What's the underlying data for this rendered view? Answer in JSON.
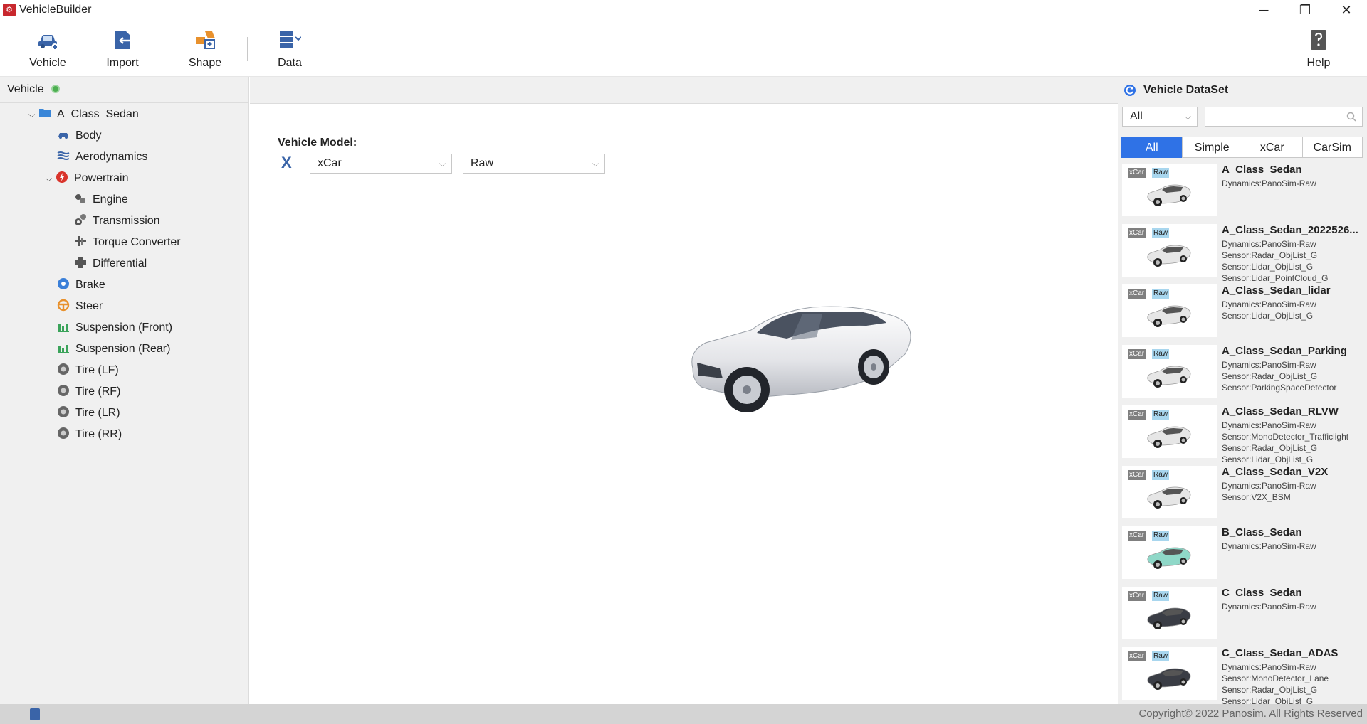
{
  "app": {
    "title": "VehicleBuilder",
    "icon": "app-logo-icon"
  },
  "window_controls": {
    "minimize": "─",
    "maximize": "❐",
    "close": "✕"
  },
  "toolbar": {
    "vehicle": "Vehicle",
    "import": "Import",
    "shape": "Shape",
    "data": "Data",
    "help": "Help"
  },
  "left_panel": {
    "title": "Vehicle",
    "root": "A_Class_Sedan",
    "items": [
      {
        "label": "Body",
        "icon": "car-body-icon"
      },
      {
        "label": "Aerodynamics",
        "icon": "wind-icon"
      },
      {
        "label": "Powertrain",
        "icon": "power-icon"
      },
      {
        "label": "Engine",
        "icon": "engine-icon"
      },
      {
        "label": "Transmission",
        "icon": "gear-icon"
      },
      {
        "label": "Torque Converter",
        "icon": "converter-icon"
      },
      {
        "label": "Differential",
        "icon": "differential-icon"
      },
      {
        "label": "Brake",
        "icon": "brake-icon"
      },
      {
        "label": "Steer",
        "icon": "steering-wheel-icon"
      },
      {
        "label": "Suspension (Front)",
        "icon": "suspension-icon"
      },
      {
        "label": "Suspension (Rear)",
        "icon": "suspension-icon"
      },
      {
        "label": "Tire (LF)",
        "icon": "tire-icon"
      },
      {
        "label": "Tire (RF)",
        "icon": "tire-icon"
      },
      {
        "label": "Tire (LR)",
        "icon": "tire-icon"
      },
      {
        "label": "Tire (RR)",
        "icon": "tire-icon"
      }
    ]
  },
  "main": {
    "vehicle_model_label": "Vehicle Model:",
    "model_icon": "X",
    "model_select": "xCar",
    "type_select": "Raw"
  },
  "right_panel": {
    "title": "Vehicle DataSet",
    "filter": "All",
    "search_placeholder": "",
    "tabs": [
      "All",
      "Simple",
      "xCar",
      "CarSim"
    ],
    "active_tab": "All",
    "badge1": "xCar",
    "badge2": "Raw",
    "cards": [
      {
        "name": "A_Class_Sedan",
        "desc": [
          "Dynamics:PanoSim-Raw"
        ],
        "color": "#e6e6e6"
      },
      {
        "name": "A_Class_Sedan_2022526...",
        "desc": [
          "Dynamics:PanoSim-Raw",
          "Sensor:Radar_ObjList_G",
          "Sensor:Lidar_ObjList_G",
          "Sensor:Lidar_PointCloud_G"
        ],
        "color": "#e6e6e6"
      },
      {
        "name": "A_Class_Sedan_lidar",
        "desc": [
          "Dynamics:PanoSim-Raw",
          "Sensor:Lidar_ObjList_G"
        ],
        "color": "#e6e6e6"
      },
      {
        "name": "A_Class_Sedan_Parking",
        "desc": [
          "Dynamics:PanoSim-Raw",
          "Sensor:Radar_ObjList_G",
          "Sensor:ParkingSpaceDetector"
        ],
        "color": "#e6e6e6"
      },
      {
        "name": "A_Class_Sedan_RLVW",
        "desc": [
          "Dynamics:PanoSim-Raw",
          "Sensor:MonoDetector_Trafficlight",
          "Sensor:Radar_ObjList_G",
          "Sensor:Lidar_ObjList_G"
        ],
        "color": "#e6e6e6"
      },
      {
        "name": "A_Class_Sedan_V2X",
        "desc": [
          "Dynamics:PanoSim-Raw",
          "Sensor:V2X_BSM"
        ],
        "color": "#e6e6e6"
      },
      {
        "name": "B_Class_Sedan",
        "desc": [
          "Dynamics:PanoSim-Raw"
        ],
        "color": "#8fd8c8"
      },
      {
        "name": "C_Class_Sedan",
        "desc": [
          "Dynamics:PanoSim-Raw"
        ],
        "color": "#3a3d45"
      },
      {
        "name": "C_Class_Sedan_ADAS",
        "desc": [
          "Dynamics:PanoSim-Raw",
          "Sensor:MonoDetector_Lane",
          "Sensor:Radar_ObjList_G",
          "Sensor:Lidar_ObjList_G"
        ],
        "color": "#3a3d45"
      }
    ]
  },
  "status_bar": {
    "copyright": "Copyright© 2022 Panosim. All Rights Reserved"
  }
}
